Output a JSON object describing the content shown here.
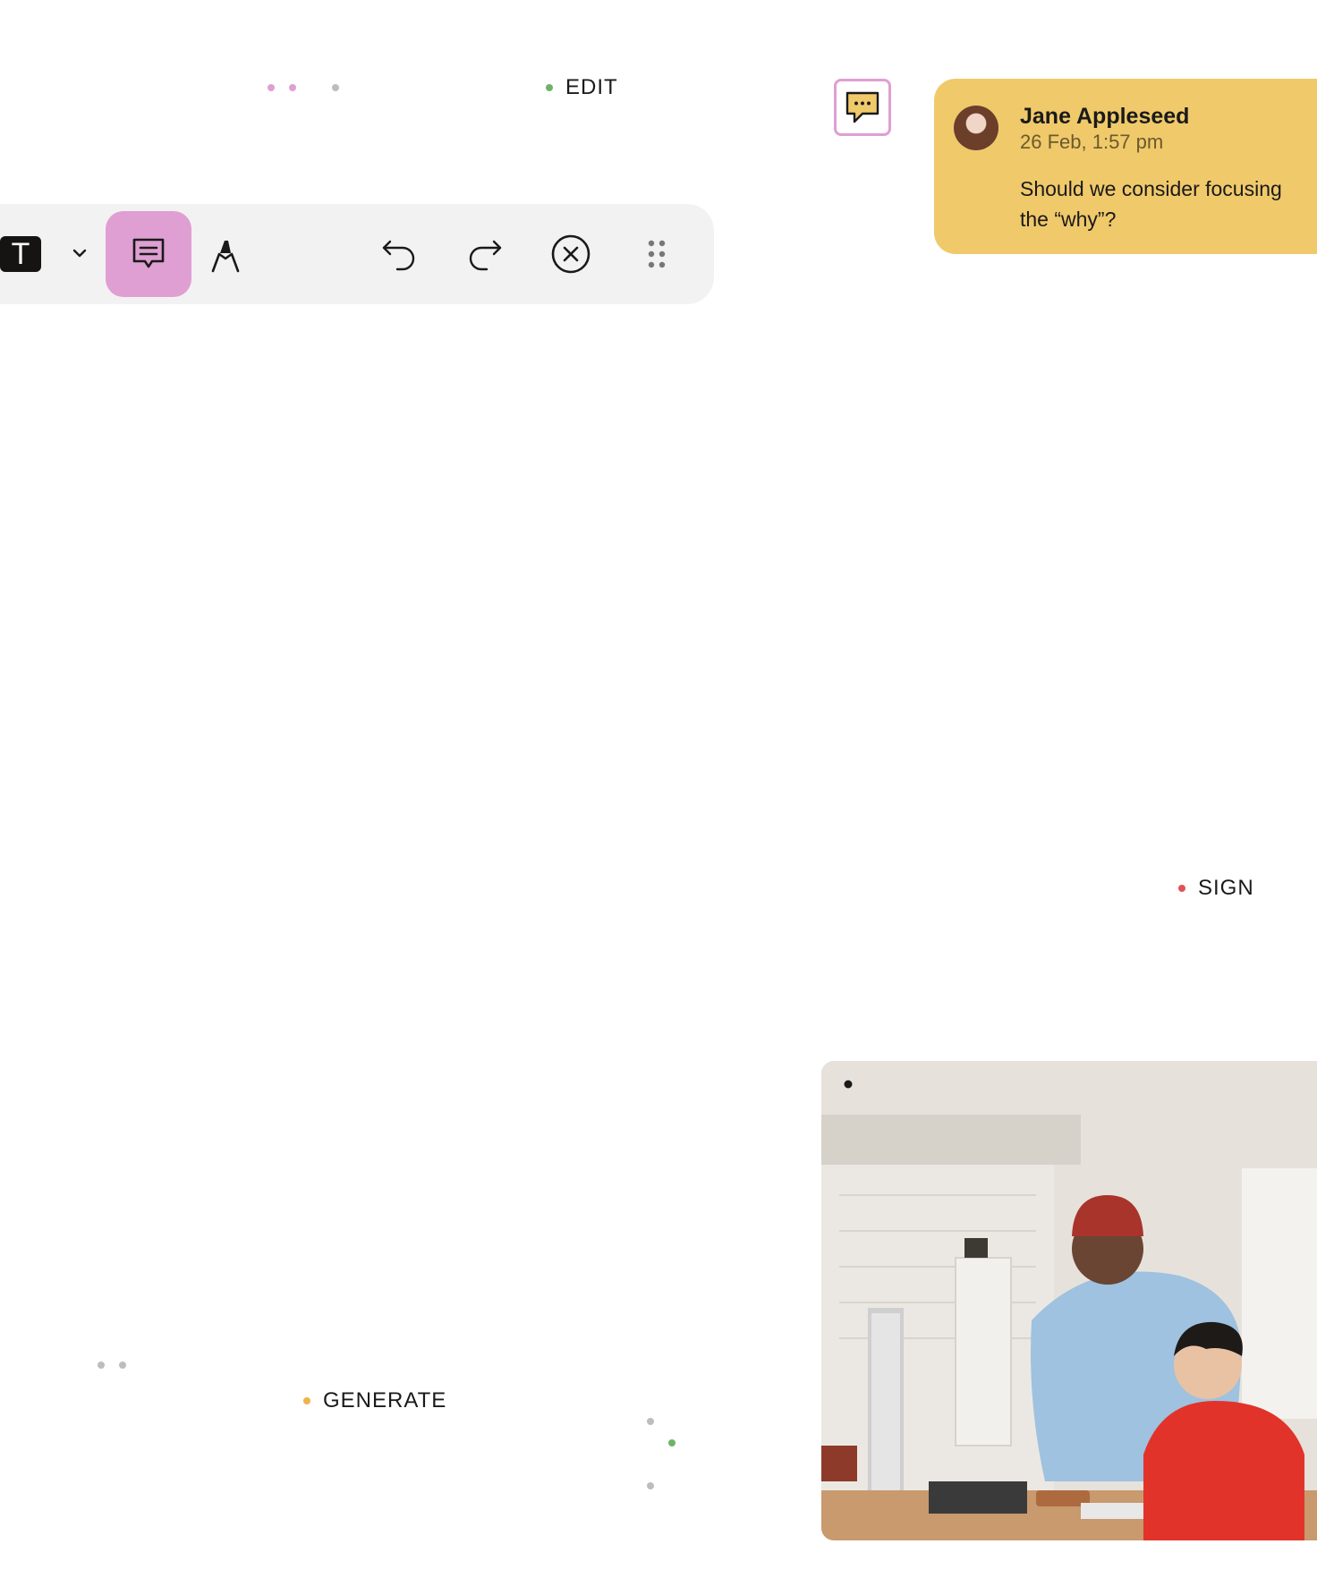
{
  "tags": {
    "edit": "EDIT",
    "sign": "SIGN",
    "generate": "GENERATE"
  },
  "colors": {
    "green": "#6fb36b",
    "red": "#e0525a",
    "orange": "#f0b24a",
    "pink": "#df9fd3",
    "gray": "#bdbdbd",
    "card": "#f0c96a",
    "toolbar": "#f2f2f2"
  },
  "toolbar": {
    "text_tool_label": "T",
    "icons": [
      "text-tool-icon",
      "chevron-down-icon",
      "comment-icon",
      "pen-icon",
      "undo-icon",
      "redo-icon",
      "close-circle-icon",
      "drag-handle-icon"
    ]
  },
  "comment": {
    "author": "Jane Appleseed",
    "timestamp": "26 Feb, 1:57 pm",
    "line1": "Should we consider focusing",
    "line2": "the “why”?"
  }
}
